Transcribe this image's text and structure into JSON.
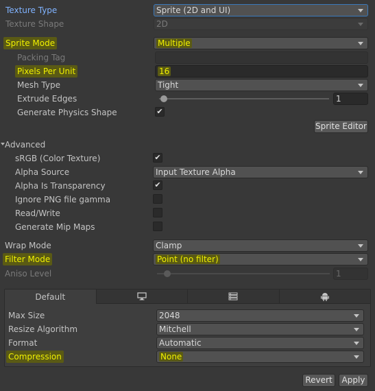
{
  "texture_type": {
    "label": "Texture Type",
    "value": "Sprite (2D and UI)"
  },
  "texture_shape": {
    "label": "Texture Shape",
    "value": "2D"
  },
  "sprite_mode": {
    "label": "Sprite Mode",
    "value": "Multiple"
  },
  "packing_tag": {
    "label": "Packing Tag",
    "value": ""
  },
  "pixels_per_unit": {
    "label": "Pixels Per Unit",
    "value": "16"
  },
  "mesh_type": {
    "label": "Mesh Type",
    "value": "Tight"
  },
  "extrude_edges": {
    "label": "Extrude Edges",
    "value": "1"
  },
  "generate_physics_shape": {
    "label": "Generate Physics Shape",
    "checked": true
  },
  "sprite_editor_button": "Sprite Editor",
  "advanced": {
    "label": "Advanced",
    "srgb": {
      "label": "sRGB (Color Texture)",
      "checked": true
    },
    "alpha_source": {
      "label": "Alpha Source",
      "value": "Input Texture Alpha"
    },
    "alpha_is_transparency": {
      "label": "Alpha Is Transparency",
      "checked": true
    },
    "ignore_png_gamma": {
      "label": "Ignore PNG file gamma",
      "checked": false
    },
    "read_write": {
      "label": "Read/Write",
      "checked": false
    },
    "generate_mip_maps": {
      "label": "Generate Mip Maps",
      "checked": false
    }
  },
  "wrap_mode": {
    "label": "Wrap Mode",
    "value": "Clamp"
  },
  "filter_mode": {
    "label": "Filter Mode",
    "value": "Point (no filter)"
  },
  "aniso_level": {
    "label": "Aniso Level",
    "value": "1"
  },
  "platform": {
    "tabs": [
      {
        "label": "Default",
        "icon": ""
      },
      {
        "label": "",
        "icon": "monitor-icon"
      },
      {
        "label": "",
        "icon": "server-icon"
      },
      {
        "label": "",
        "icon": "android-icon"
      }
    ],
    "max_size": {
      "label": "Max Size",
      "value": "2048"
    },
    "resize_algorithm": {
      "label": "Resize Algorithm",
      "value": "Mitchell"
    },
    "format": {
      "label": "Format",
      "value": "Automatic"
    },
    "compression": {
      "label": "Compression",
      "value": "None"
    }
  },
  "buttons": {
    "revert": "Revert",
    "apply": "Apply"
  },
  "colors": {
    "background": "#383838",
    "highlight": "#f0f000",
    "link_blue": "#80b3ff"
  }
}
